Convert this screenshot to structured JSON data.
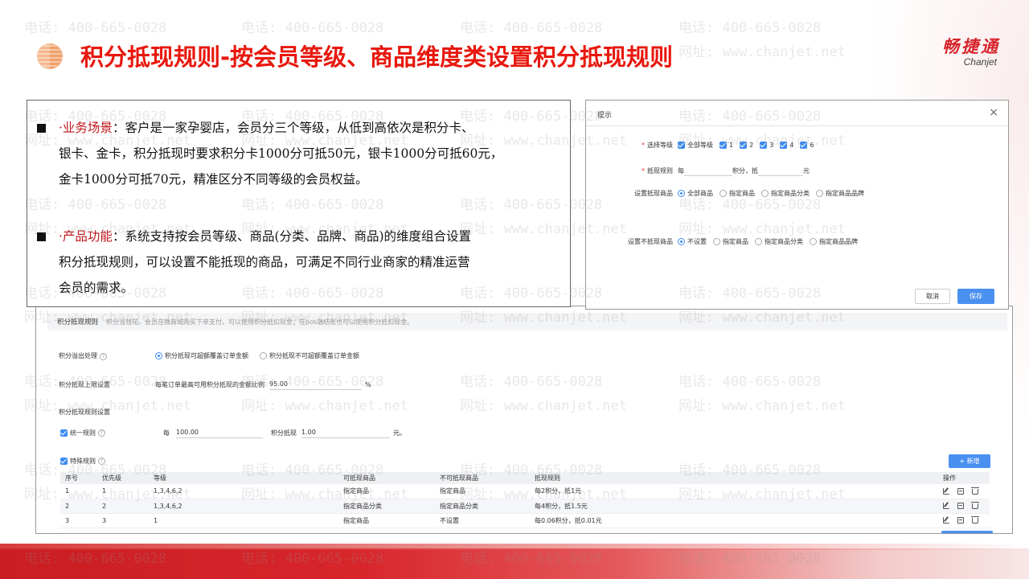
{
  "header": {
    "title": "积分抵现规则-按会员等级、商品维度类设置积分抵现规则",
    "brand_cn": "畅捷通",
    "brand_en": "Chanjet"
  },
  "watermark": {
    "phone": "电话: 400-665-0028",
    "site": "网址: www.chanjet.net"
  },
  "description": {
    "bullet1": {
      "label": "·业务场景",
      "lines": [
        "：客户是一家孕婴店，会员分三个等级，从低到高依次是积分卡、",
        "银卡、金卡，积分抵现时要求积分卡1000分可抵50元，银卡1000分可抵60元，",
        "金卡1000分可抵70元，精准区分不同等级的会员权益。"
      ]
    },
    "bullet2": {
      "label": "·产品功能",
      "lines": [
        "：系统支持按会员等级、商品(分类、品牌、商品)的维度组合设置",
        "积分抵现规则，可以设置不能抵现的商品，可满足不同行业商家的精准运营",
        "会员的需求。"
      ]
    }
  },
  "dialog": {
    "title": "提示",
    "close": "×",
    "level_label": "选择等级",
    "levels": [
      "全部等级",
      "1",
      "2",
      "3",
      "4",
      "6"
    ],
    "rule_label": "抵现规则",
    "rule_prefix": "每",
    "rule_mid": "积分，抵",
    "rule_suffix": "元",
    "goods_label": "设置抵现商品",
    "goods_options": [
      "全部商品",
      "指定商品",
      "指定商品分类",
      "指定商品品牌"
    ],
    "goods_selected": "全部商品",
    "exclude_label": "设置不抵现商品",
    "exclude_options": [
      "不设置",
      "指定商品",
      "指定商品分类",
      "指定商品品牌"
    ],
    "exclude_selected": "不设置",
    "cancel": "取消",
    "save": "保存"
  },
  "settings": {
    "title": "积分抵现规则",
    "desc": "积分当钱花，会员在微商城购买下单支付，可以使用积分抵扣现金；在pos端结账也可以使用积分抵扣现金。",
    "overflow_label": "积分溢出处理",
    "overflow_options": [
      "积分抵现可超额覆盖订单金额",
      "积分抵现不可超额覆盖订单金额"
    ],
    "overflow_selected": "积分抵现可超额覆盖订单金额",
    "limit_label": "积分抵现上限设置",
    "limit_text": "每笔订单最高可用积分抵现的金额比例",
    "limit_value": "95.00",
    "limit_unit": "%",
    "rule_section_label": "积分抵现规则设置",
    "unified_label": "统一规则",
    "unified_prefix": "每",
    "unified_points": "100.00",
    "unified_mid": "积分抵现",
    "unified_amount": "1.00",
    "unified_suffix": "元。",
    "special_label": "特殊规则",
    "add_button": "+ 新增",
    "table": {
      "headers": [
        "序号",
        "优先级",
        "等级",
        "可抵现商品",
        "不可抵现商品",
        "抵现规则",
        "操作"
      ],
      "rows": [
        [
          "1",
          "1",
          "1,3,4,6,2",
          "指定商品",
          "指定商品",
          "每2积分，抵1元"
        ],
        [
          "2",
          "2",
          "1,3,4,6,2",
          "指定商品分类",
          "指定商品分类",
          "每4积分，抵1.5元"
        ],
        [
          "3",
          "3",
          "1",
          "指定商品",
          "不设置",
          "每0.06积分，抵0.01元"
        ]
      ]
    }
  },
  "colors": {
    "title_red": "#e8180e",
    "highlight_red": "#c0141b",
    "accent_blue": "#4a90f0",
    "bottom_red": "#c91d22"
  }
}
